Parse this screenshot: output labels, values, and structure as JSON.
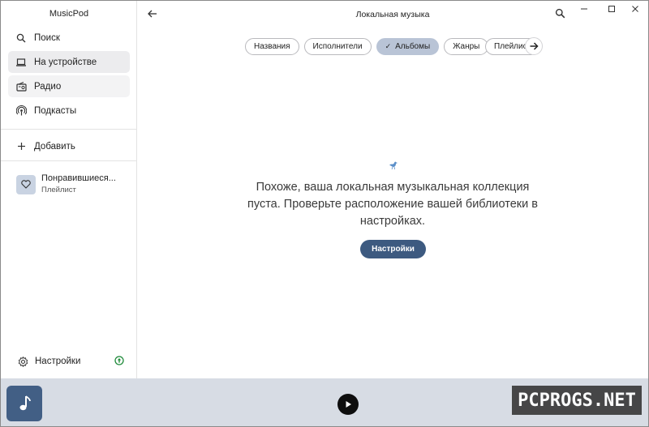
{
  "app": {
    "title": "MusicPod"
  },
  "sidebar": {
    "items": [
      {
        "label": "Поиск",
        "icon": "search-icon"
      },
      {
        "label": "На устройстве",
        "icon": "laptop-icon"
      },
      {
        "label": "Радио",
        "icon": "radio-icon"
      },
      {
        "label": "Подкасты",
        "icon": "podcast-icon"
      }
    ],
    "add_label": "Добавить",
    "playlist": {
      "title": "Понравившиеся...",
      "subtitle": "Плейлист",
      "icon": "heart-icon"
    },
    "settings_label": "Настройки"
  },
  "header": {
    "title": "Локальная музыка"
  },
  "chips": [
    {
      "label": "Названия",
      "selected": false
    },
    {
      "label": "Исполнители",
      "selected": false
    },
    {
      "label": "Альбомы",
      "selected": true
    },
    {
      "label": "Жанры",
      "selected": false
    },
    {
      "label": "Плейлис",
      "selected": false
    }
  ],
  "empty_state": {
    "message": "Похоже, ваша локальная музыкальная коллекция пуста. Проверьте расположение вашей библиотеки в настройках.",
    "button_label": "Настройки"
  },
  "watermark": "PCPROGS.NET",
  "colors": {
    "accent": "#3d5a80",
    "chip_selected": "#b9c4d6",
    "player_bg": "#d7dce4",
    "update_green": "#1f8a3a"
  }
}
